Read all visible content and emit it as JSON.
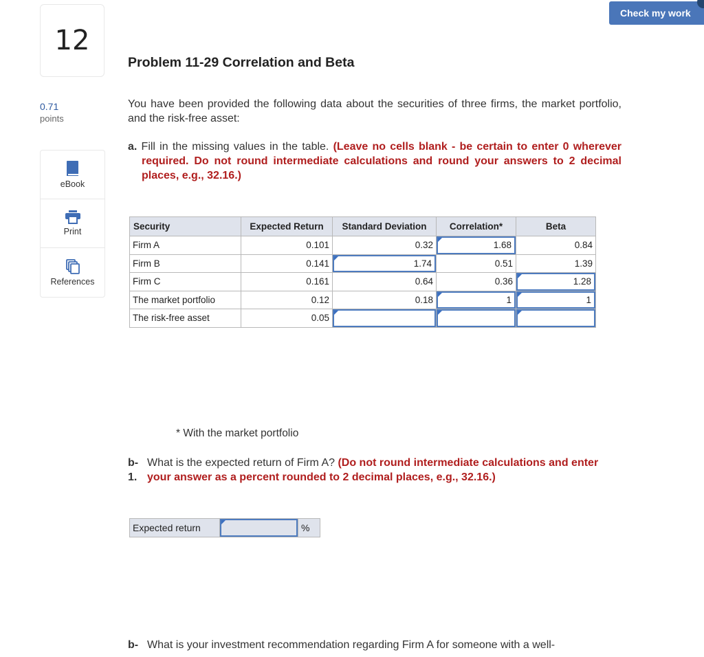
{
  "question": {
    "number": "12",
    "points_value": "0.71",
    "points_label": "points"
  },
  "tools": [
    {
      "label": "eBook",
      "icon": "book-icon"
    },
    {
      "label": "Print",
      "icon": "printer-icon"
    },
    {
      "label": "References",
      "icon": "references-icon"
    }
  ],
  "header": {
    "check_button": "Check my work"
  },
  "problem": {
    "title": "Problem 11-29 Correlation and Beta",
    "intro": "You have been provided the following data about the securities of three firms, the market portfolio, and the risk-free asset:",
    "part_a": {
      "prefix": "a.",
      "text": " Fill in the missing values in the table. ",
      "instruction": "(Leave no cells blank - be certain to enter 0 wherever required. Do not round intermediate calculations and round your answers to 2 decimal places, e.g., 32.16.)"
    },
    "table": {
      "headers": [
        "Security",
        "Expected Return",
        "Standard Deviation",
        "Correlation*",
        "Beta"
      ],
      "rows": [
        {
          "security": "Firm A",
          "expected_return": "0.101",
          "std_dev": "0.32",
          "correlation": "1.68",
          "beta": "0.84"
        },
        {
          "security": "Firm B",
          "expected_return": "0.141",
          "std_dev": "1.74",
          "correlation": "0.51",
          "beta": "1.39"
        },
        {
          "security": "Firm C",
          "expected_return": "0.161",
          "std_dev": "0.64",
          "correlation": "0.36",
          "beta": "1.28"
        },
        {
          "security": "The market portfolio",
          "expected_return": "0.12",
          "std_dev": "0.18",
          "correlation": "1",
          "beta": "1"
        },
        {
          "security": "The risk-free asset",
          "expected_return": "0.05",
          "std_dev": "",
          "correlation": "",
          "beta": ""
        }
      ]
    },
    "footnote": "* With the market portfolio",
    "part_b1": {
      "prefix": "b-\n1.",
      "prefix_line1": "b-",
      "prefix_line2": "1.",
      "text": "What is the expected return of Firm A? ",
      "instruction": "(Do not round intermediate calculations and enter your answer as a percent rounded to 2 decimal places, e.g., 32.16.)"
    },
    "expected_return_row": {
      "label": "Expected return",
      "value": "",
      "unit": "%"
    },
    "part_b2": {
      "prefix": "b-",
      "text": "What is your investment recommendation regarding Firm A for someone with a well-"
    }
  }
}
